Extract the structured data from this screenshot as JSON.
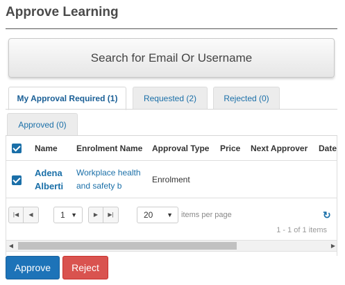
{
  "page": {
    "title": "Approve Learning"
  },
  "search": {
    "label": "Search for Email Or Username"
  },
  "tabs": [
    {
      "label": "My Approval Required (1)",
      "active": true
    },
    {
      "label": "Requested (2)",
      "active": false
    },
    {
      "label": "Rejected (0)",
      "active": false
    },
    {
      "label": "Approved (0)",
      "active": false
    }
  ],
  "table": {
    "columns": [
      "Name",
      "Enrolment Name",
      "Approval Type",
      "Price",
      "Next Approver",
      "Date"
    ],
    "header_checked": true,
    "rows": [
      {
        "checked": true,
        "name": "Adena Alberti",
        "enrolment_name": "Workplace health and safety b",
        "approval_type": "Enrolment",
        "price": "",
        "next_approver": "",
        "date": ""
      }
    ]
  },
  "pager": {
    "page": "1",
    "page_size": "20",
    "items_per_page_label": "items per page",
    "info": "1 - 1 of 1 items"
  },
  "actions": {
    "approve_label": "Approve",
    "reject_label": "Reject"
  },
  "colors": {
    "accent": "#1d73b8",
    "danger": "#d9534f",
    "link": "#1a6fa8"
  }
}
